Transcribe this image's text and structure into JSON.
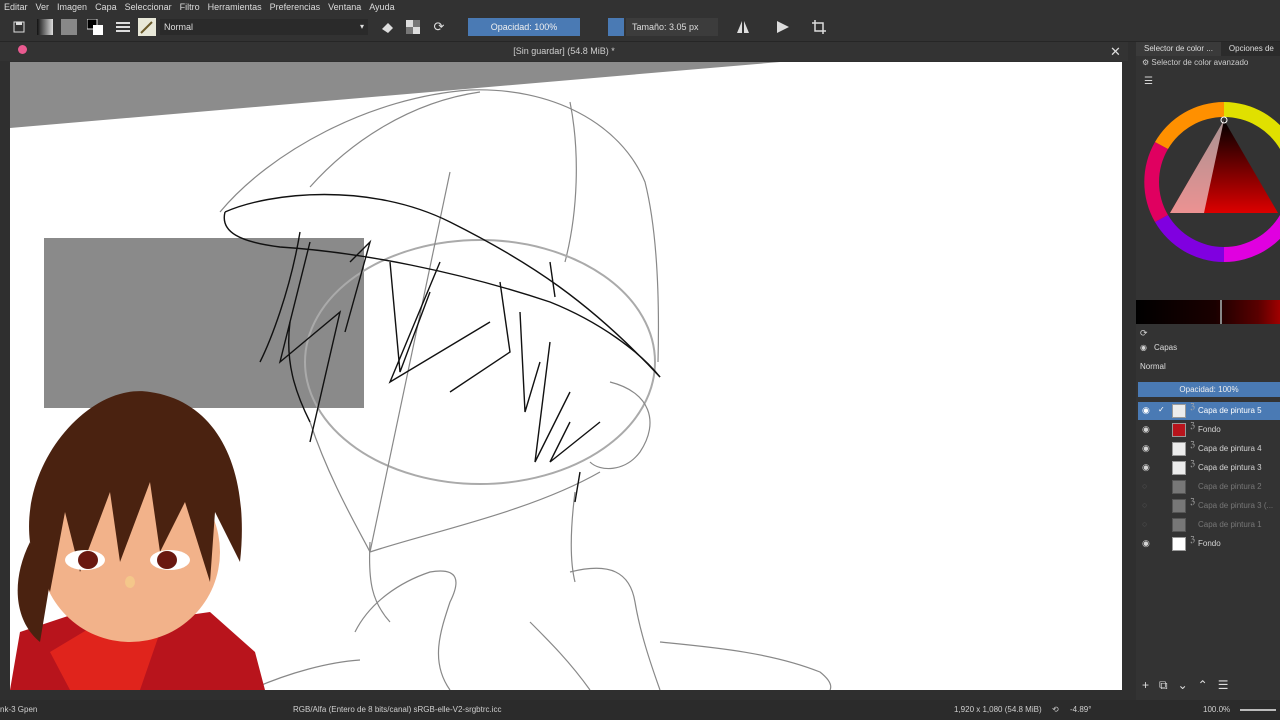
{
  "menu": [
    "Editar",
    "Ver",
    "Imagen",
    "Capa",
    "Seleccionar",
    "Filtro",
    "Herramientas",
    "Preferencias",
    "Ventana",
    "Ayuda"
  ],
  "toolbar": {
    "blend_mode": "Normal",
    "opacity_label": "Opacidad: 100%",
    "size_label": "Tamaño: 3.05 px"
  },
  "document": {
    "title": "[Sin guardar]  (54.8 MiB) *"
  },
  "dock": {
    "tab1": "Selector de color ...",
    "tab2": "Opciones de",
    "advanced_label": "Selector de color avanzado",
    "layers_title": "Capas",
    "layers_blend": "Normal",
    "layers_opacity": "Opacidad:  100%",
    "layers": [
      {
        "name": "Capa de pintura 5",
        "visible": true,
        "active": true
      },
      {
        "name": "Fondo",
        "visible": true,
        "active": false
      },
      {
        "name": "Capa de pintura 4",
        "visible": true,
        "active": false
      },
      {
        "name": "Capa de pintura 3",
        "visible": true,
        "active": false
      },
      {
        "name": "Capa de pintura 2",
        "visible": false,
        "active": false
      },
      {
        "name": "Capa de pintura 3 (...",
        "visible": false,
        "active": false
      },
      {
        "name": "Capa de pintura 1",
        "visible": false,
        "active": false
      },
      {
        "name": "Fondo",
        "visible": true,
        "active": false
      }
    ]
  },
  "status": {
    "brush": "nk-3 Gpen",
    "color_space": "RGB/Alfa (Entero de 8 bits/canal)  sRGB-elle-V2-srgbtrc.icc",
    "dimensions": "1,920 x 1,080 (54.8 MiB)",
    "rotation": "-4.89°",
    "zoom": "100.0%"
  },
  "colors": {
    "accent": "#4a7ab4",
    "panel": "#333333"
  }
}
